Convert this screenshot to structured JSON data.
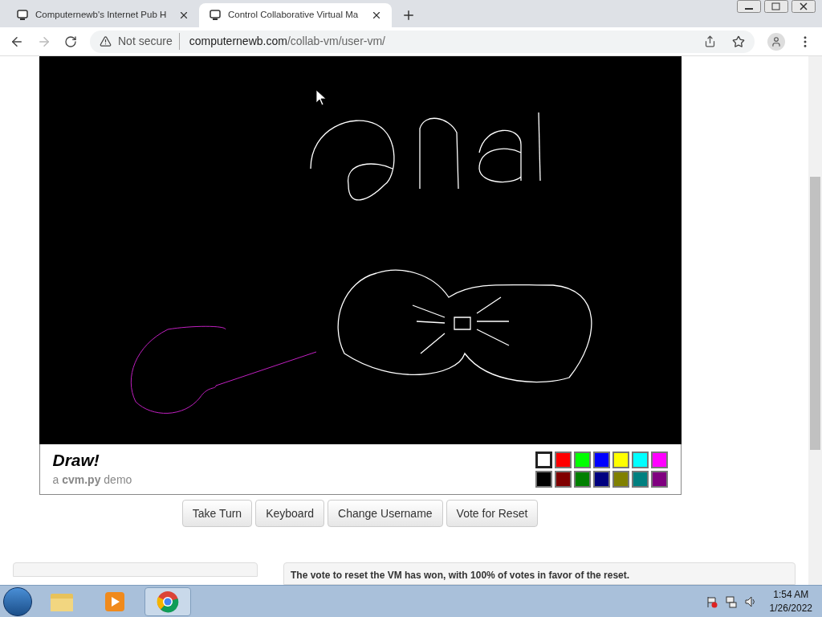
{
  "browser": {
    "tabs": [
      {
        "title": "Computernewb's Internet Pub H",
        "selected": false
      },
      {
        "title": "Control Collaborative Virtual Ma",
        "selected": true
      }
    ],
    "security": "Not secure",
    "url_host": "computernewb.com",
    "url_path": "/collab-vm/user-vm/"
  },
  "app": {
    "title": "Draw!",
    "subtitle": "a **cvm.py** demo",
    "palette": [
      {
        "color": "#ffffff",
        "selected": true
      },
      {
        "color": "#ff0000",
        "selected": false
      },
      {
        "color": "#00ff00",
        "selected": false
      },
      {
        "color": "#0000ff",
        "selected": false
      },
      {
        "color": "#ffff00",
        "selected": false
      },
      {
        "color": "#00ffff",
        "selected": false
      },
      {
        "color": "#ff00ff",
        "selected": false
      },
      {
        "color": "#000000",
        "selected": false
      },
      {
        "color": "#800000",
        "selected": false
      },
      {
        "color": "#008000",
        "selected": false
      },
      {
        "color": "#000080",
        "selected": false
      },
      {
        "color": "#808000",
        "selected": false
      },
      {
        "color": "#008080",
        "selected": false
      },
      {
        "color": "#800080",
        "selected": false
      }
    ],
    "buttons": [
      "Take Turn",
      "Keyboard",
      "Change Username",
      "Vote for Reset"
    ],
    "chat_message": "The vote to reset the VM has won, with 100% of votes in favor of the reset."
  },
  "taskbar": {
    "time": "1:54 AM",
    "date": "1/26/2022"
  }
}
